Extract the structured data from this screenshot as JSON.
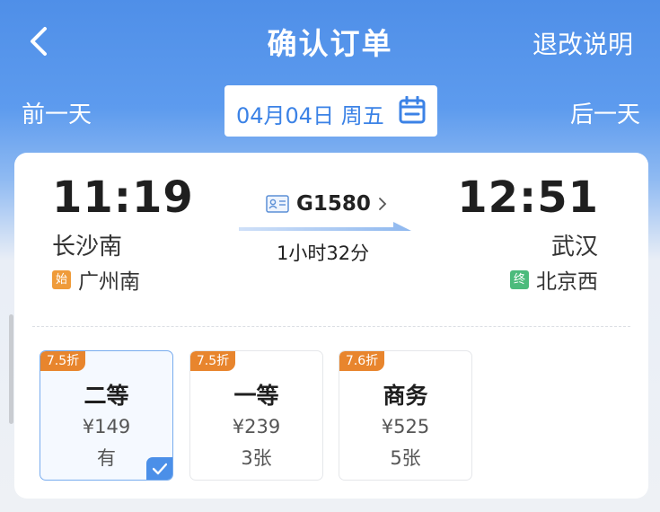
{
  "header": {
    "title": "确认订单",
    "rules_link": "退改说明"
  },
  "date_bar": {
    "prev_day": "前一天",
    "date": "04月04日 周五",
    "next_day": "后一天"
  },
  "trip": {
    "departure_time": "11:19",
    "departure_station": "长沙南",
    "origin_tag": "始",
    "origin_station": "广州南",
    "train_number": "G1580",
    "duration": "1小时32分",
    "arrival_time": "12:51",
    "arrival_station": "武汉",
    "destination_tag": "终",
    "destination_station": "北京西"
  },
  "seats": [
    {
      "discount": "7.5折",
      "class": "二等",
      "price": "¥149",
      "availability": "有",
      "selected": true
    },
    {
      "discount": "7.5折",
      "class": "一等",
      "price": "¥239",
      "availability": "3张",
      "selected": false
    },
    {
      "discount": "7.6折",
      "class": "商务",
      "price": "¥525",
      "availability": "5张",
      "selected": false
    }
  ],
  "colors": {
    "brand_blue": "#4f8fe8",
    "discount_orange": "#e8852d",
    "origin_tag": "#ef9b3a",
    "destination_tag": "#4cbb7c"
  },
  "icons": [
    "back-arrow-icon",
    "calendar-icon",
    "id-card-icon",
    "chevron-right-icon",
    "check-icon"
  ]
}
